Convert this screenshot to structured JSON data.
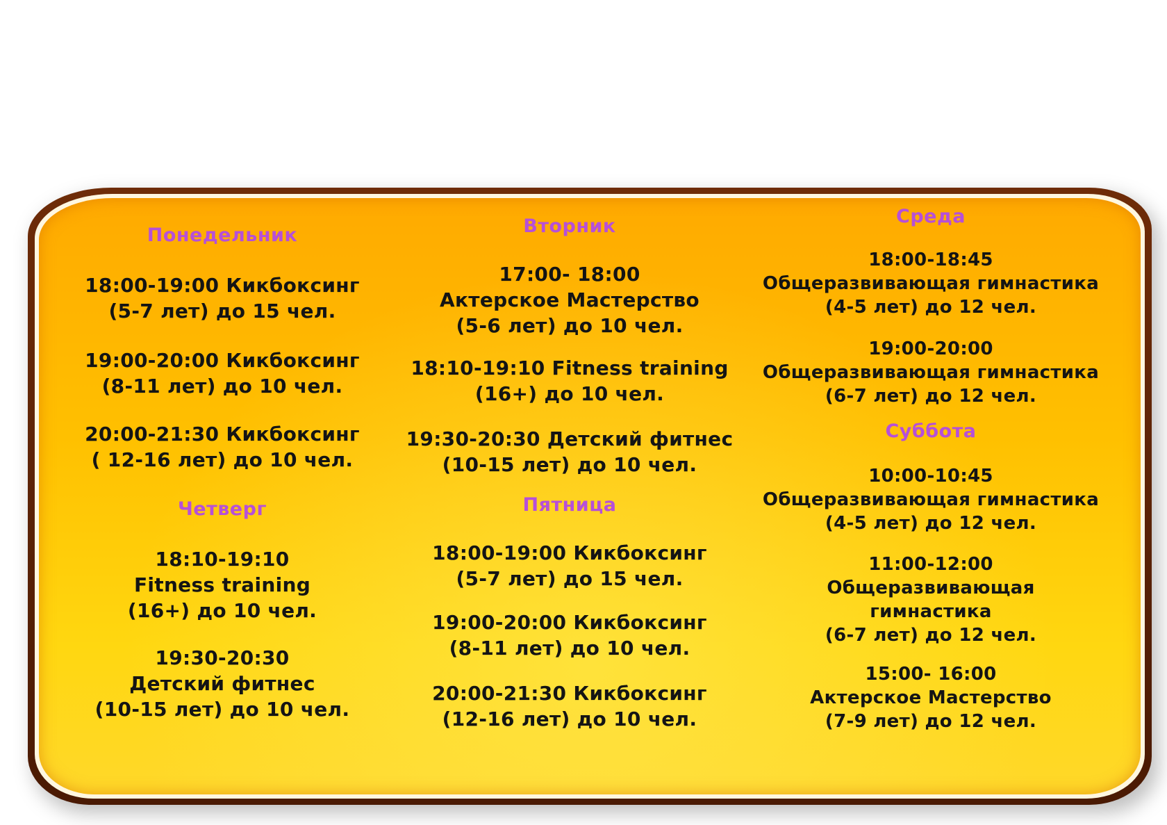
{
  "columns": [
    {
      "days": [
        {
          "name": "Понедельник",
          "entries": [
            {
              "lines": [
                "18:00-19:00 Кикбоксинг",
                "(5-7 лет) до 15 чел."
              ]
            },
            {
              "lines": [
                "19:00-20:00 Кикбоксинг",
                "(8-11 лет) до 10 чел."
              ]
            },
            {
              "lines": [
                "20:00-21:30 Кикбоксинг",
                "( 12-16 лет) до 10 чел."
              ]
            }
          ]
        },
        {
          "name": "Четверг",
          "entries": [
            {
              "lines": [
                "18:10-19:10",
                "Fitness training",
                "(16+) до 10 чел."
              ]
            },
            {
              "lines": [
                "19:30-20:30",
                "Детский фитнес",
                "(10-15 лет) до 10 чел."
              ]
            }
          ]
        }
      ]
    },
    {
      "days": [
        {
          "name": "Вторник",
          "entries": [
            {
              "lines": [
                "17:00- 18:00",
                "Актерское Мастерство",
                "(5-6 лет) до 10 чел."
              ]
            },
            {
              "lines": [
                "18:10-19:10 Fitness training",
                "(16+) до 10 чел."
              ]
            },
            {
              "lines": [
                "19:30-20:30 Детский фитнес",
                "(10-15 лет) до 10 чел."
              ]
            }
          ]
        },
        {
          "name": "Пятница",
          "entries": [
            {
              "lines": [
                "18:00-19:00 Кикбоксинг",
                "(5-7 лет) до 15 чел."
              ]
            },
            {
              "lines": [
                "19:00-20:00 Кикбоксинг",
                "(8-11 лет) до 10 чел."
              ]
            },
            {
              "lines": [
                "20:00-21:30 Кикбоксинг",
                "(12-16 лет) до 10 чел."
              ]
            }
          ]
        }
      ]
    },
    {
      "days": [
        {
          "name": "Среда",
          "entries": [
            {
              "lines": [
                "18:00-18:45",
                "Общеразвивающая гимнастика",
                "(4-5 лет) до 12 чел."
              ]
            },
            {
              "lines": [
                "19:00-20:00",
                "Общеразвивающая гимнастика",
                "(6-7 лет) до 12 чел."
              ]
            }
          ]
        },
        {
          "name": "Суббота",
          "entries": [
            {
              "lines": [
                "10:00-10:45",
                "Общеразвивающая гимнастика",
                "(4-5 лет) до 12 чел."
              ]
            },
            {
              "lines": [
                "11:00-12:00",
                "Общеразвивающая",
                "гимнастика",
                "(6-7 лет) до 12 чел."
              ]
            },
            {
              "lines": [
                "15:00- 16:00",
                "Актерское Мастерство",
                "(7-9 лет) до 12 чел."
              ]
            }
          ]
        }
      ]
    }
  ]
}
